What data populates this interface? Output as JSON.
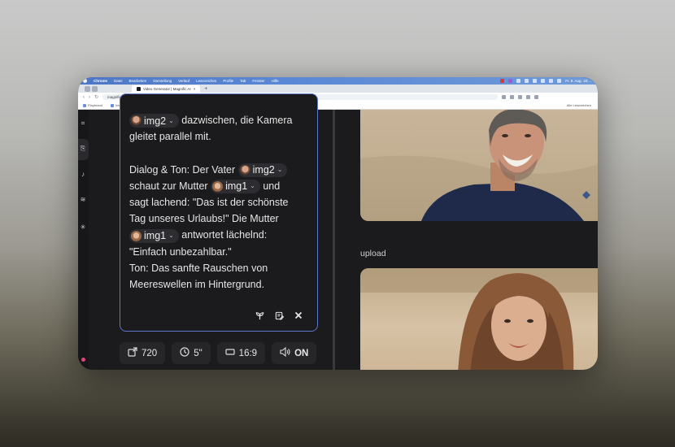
{
  "menubar": {
    "app": "Chrome",
    "items": [
      "Datei",
      "Bearbeiten",
      "Darstellung",
      "Verlauf",
      "Lesezeichen",
      "Profile",
      "Tab",
      "Fenster",
      "Hilfe"
    ],
    "clock": "Fr. 8. Aug. 18:..."
  },
  "browser": {
    "tab_title": "Video Generator | Magnific AI",
    "new_tab": "+",
    "url": "magnific.com/pixelz-video-generator",
    "bookmarks": [
      "Playbrand",
      "Intuitive AI",
      "Playbrand",
      "Gemini"
    ],
    "all_bookmarks": "Alle Lesezeichen"
  },
  "prompt": {
    "line1_chip": "img2",
    "line1_text": "dazwischen, die Kamera",
    "line2": "gleitet parallel mit.",
    "line3_pre": "Dialog & Ton: Der Vater",
    "line3_chip": "img2",
    "line4_pre": "schaut zur Mutter",
    "line4_chip": "img1",
    "line4_post": "und",
    "line5": "sagt lachend: \"Das ist der schönste",
    "line6": "Tag unseres Urlaubs!\" Die Mutter",
    "line7_chip": "img1",
    "line7_post": "antwortet lächelnd:",
    "line8": "\"Einfach unbezahlbar.\"",
    "line9": "Ton: Das sanfte Rauschen von",
    "line10": "Meereswellen im Hintergrund."
  },
  "settings": {
    "resolution": "720",
    "duration": "5\"",
    "aspect": "16:9",
    "audio": "ON"
  },
  "right": {
    "upload_label": "upload"
  },
  "icons": {
    "tool1": "sprout-icon",
    "tool2": "edit-note-icon",
    "tool3": "close-icon"
  }
}
